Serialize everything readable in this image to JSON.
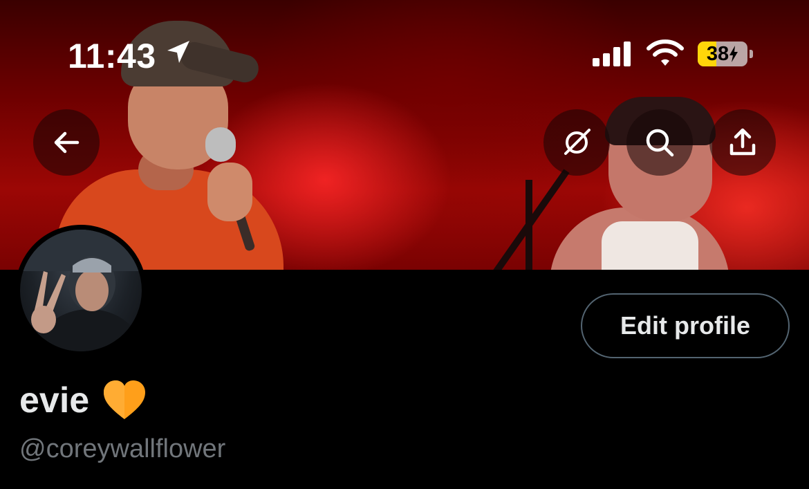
{
  "status_bar": {
    "time": "11:43",
    "battery_level": "38",
    "battery_fraction": 0.38,
    "battery_color": "#ffd60a",
    "icons": [
      "location-arrow-icon",
      "cellular-signal-icon",
      "wifi-icon",
      "battery-charging-icon"
    ]
  },
  "header": {
    "buttons": [
      "back-arrow-icon",
      "grok-icon",
      "search-icon",
      "share-icon"
    ]
  },
  "profile": {
    "display_name": "evie",
    "name_emoji": "orange-heart-icon",
    "handle": "@coreywallflower",
    "edit_button_label": "Edit profile"
  },
  "colors": {
    "background": "#000000",
    "name_text": "#e7e9ea",
    "handle_text": "#71767b",
    "button_border": "#536471",
    "heart": "#ff9f1a"
  }
}
